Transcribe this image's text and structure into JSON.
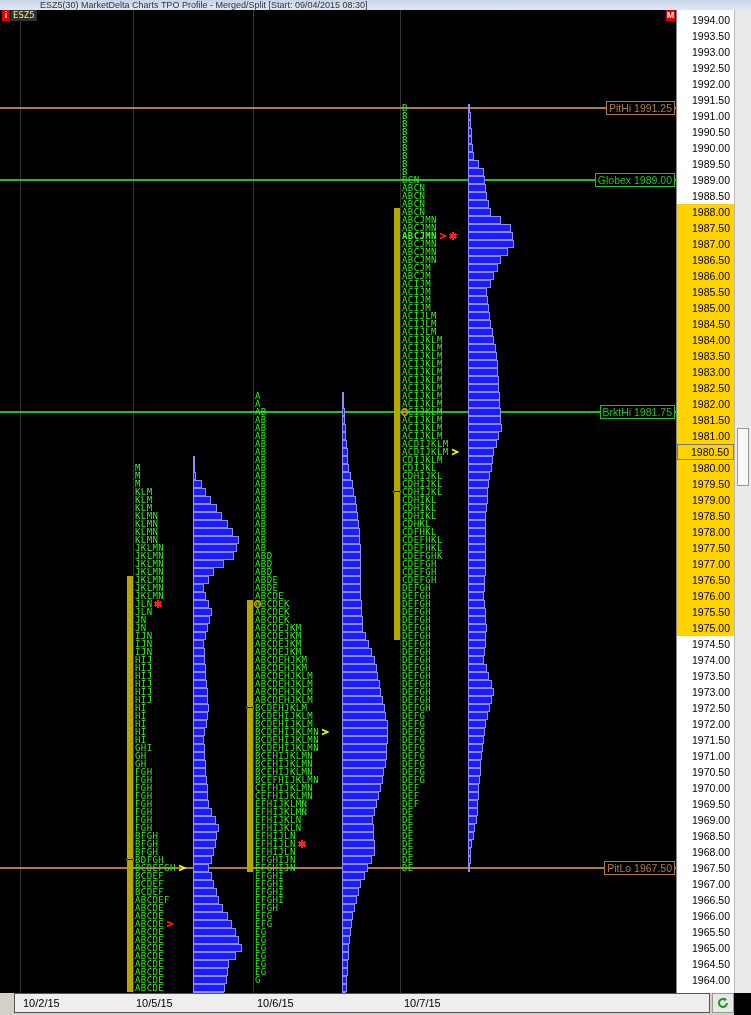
{
  "window": {
    "title": "ESZ5(30) MarketDelta Charts TPO Profile - Merged/Split [Start: 09/04/2015 08:30]"
  },
  "chart": {
    "info_badge": "i",
    "symbol": "ESZ5",
    "mode_badge": "M",
    "profiles": [
      {
        "rows": [
          {
            "tpo": "M",
            "va": false
          },
          {
            "tpo": "M",
            "va": false
          },
          {
            "tpo": "M",
            "va": false
          },
          {
            "tpo": "KLM",
            "va": false
          },
          {
            "tpo": "KLM",
            "va": false
          },
          {
            "tpo": "KLM",
            "va": false
          },
          {
            "tpo": "KLMN",
            "va": false
          },
          {
            "tpo": "KLMN",
            "va": false
          },
          {
            "tpo": "KLMN",
            "va": false
          },
          {
            "tpo": "KLMN",
            "va": false
          },
          {
            "tpo": "JKLMN",
            "va": false
          },
          {
            "tpo": "JKLMN",
            "va": false
          },
          {
            "tpo": "JKLMN",
            "va": false
          },
          {
            "tpo": "JKLMN",
            "va": false
          },
          {
            "tpo": "JKLMN",
            "va": true
          },
          {
            "tpo": "JKLMN",
            "va": true
          },
          {
            "tpo": "JKLMN",
            "va": true
          },
          {
            "tpo": "JLN",
            "va": true,
            "markers": [
              {
                "kind": "star",
                "color": "#ff2020"
              }
            ]
          },
          {
            "tpo": "JLN",
            "va": true
          },
          {
            "tpo": "JN",
            "va": true
          },
          {
            "tpo": "JN",
            "va": true
          },
          {
            "tpo": "IJN",
            "va": true
          },
          {
            "tpo": "IJN",
            "va": true
          },
          {
            "tpo": "IJN",
            "va": true
          },
          {
            "tpo": "HIJ",
            "va": true
          },
          {
            "tpo": "HIJ",
            "va": true
          },
          {
            "tpo": "HIJ",
            "va": true
          },
          {
            "tpo": "HIJ",
            "va": true
          },
          {
            "tpo": "HIJ",
            "va": true
          },
          {
            "tpo": "HIJ",
            "va": true
          },
          {
            "tpo": "HI",
            "va": true
          },
          {
            "tpo": "HI",
            "va": true
          },
          {
            "tpo": "HI",
            "va": true
          },
          {
            "tpo": "HI",
            "va": true
          },
          {
            "tpo": "HI",
            "va": true
          },
          {
            "tpo": "GHI",
            "va": true
          },
          {
            "tpo": "GH",
            "va": true
          },
          {
            "tpo": "GH",
            "va": true
          },
          {
            "tpo": "FGH",
            "va": true
          },
          {
            "tpo": "FGH",
            "va": true
          },
          {
            "tpo": "FGH",
            "va": true
          },
          {
            "tpo": "FGH",
            "va": true
          },
          {
            "tpo": "FGH",
            "va": true
          },
          {
            "tpo": "FGH",
            "va": true
          },
          {
            "tpo": "FGH",
            "va": true
          },
          {
            "tpo": "FGH",
            "va": true
          },
          {
            "tpo": "BFGH",
            "va": true
          },
          {
            "tpo": "BFGH",
            "va": true
          },
          {
            "tpo": "BFGH",
            "va": true
          },
          {
            "tpo": "BDFGH",
            "va": true,
            "mid": true
          },
          {
            "tpo": "BCDEFGH",
            "va": true,
            "markers": [
              {
                "kind": "arrow",
                "color": "#ffff00"
              }
            ]
          },
          {
            "tpo": "BCDEF",
            "va": true
          },
          {
            "tpo": "BCDEF",
            "va": true
          },
          {
            "tpo": "BCDEF",
            "va": true
          },
          {
            "tpo": "ABCDEF",
            "va": true
          },
          {
            "tpo": "ABCDE",
            "va": true
          },
          {
            "tpo": "ABCDE",
            "va": true
          },
          {
            "tpo": "ABCDE",
            "va": true,
            "markers": [
              {
                "kind": "arrow",
                "color": "#ff2020"
              }
            ]
          },
          {
            "tpo": "ABCDE",
            "va": true
          },
          {
            "tpo": "ABCDE",
            "va": true
          },
          {
            "tpo": "ABCDE",
            "va": true
          },
          {
            "tpo": "ABCDE",
            "va": true
          },
          {
            "tpo": "ABCDE",
            "va": true
          },
          {
            "tpo": "ABCDE",
            "va": true
          },
          {
            "tpo": "ABCDE",
            "va": true
          },
          {
            "tpo": "ABCDE",
            "va": true
          }
        ]
      },
      {
        "rows": [
          {
            "tpo": "A",
            "va": false
          },
          {
            "tpo": "A",
            "va": false
          },
          {
            "tpo": "AB",
            "va": false
          },
          {
            "tpo": "AB",
            "va": false
          },
          {
            "tpo": "AB",
            "va": false
          },
          {
            "tpo": "AB",
            "va": false
          },
          {
            "tpo": "AB",
            "va": false
          },
          {
            "tpo": "AB",
            "va": false
          },
          {
            "tpo": "AB",
            "va": false
          },
          {
            "tpo": "AB",
            "va": false
          },
          {
            "tpo": "AB",
            "va": false
          },
          {
            "tpo": "AB",
            "va": false
          },
          {
            "tpo": "AB",
            "va": false
          },
          {
            "tpo": "AB",
            "va": false
          },
          {
            "tpo": "AB",
            "va": false
          },
          {
            "tpo": "AB",
            "va": false
          },
          {
            "tpo": "AB",
            "va": false
          },
          {
            "tpo": "AB",
            "va": false
          },
          {
            "tpo": "AB",
            "va": false
          },
          {
            "tpo": "AB",
            "va": false
          },
          {
            "tpo": "ABD",
            "va": false
          },
          {
            "tpo": "ABD",
            "va": false
          },
          {
            "tpo": "ABD",
            "va": false
          },
          {
            "tpo": "ABDE",
            "va": false
          },
          {
            "tpo": "ABDE",
            "va": false
          },
          {
            "tpo": "ABCDE",
            "va": false
          },
          {
            "tpo": "ABCDEK",
            "va": true,
            "open": true
          },
          {
            "tpo": "ABCDEK",
            "va": true
          },
          {
            "tpo": "ABCDEK",
            "va": true
          },
          {
            "tpo": "ABCDEJKM",
            "va": true
          },
          {
            "tpo": "ABCDEJKM",
            "va": true
          },
          {
            "tpo": "ABCDEJKM",
            "va": true
          },
          {
            "tpo": "ABCDEJKM",
            "va": true
          },
          {
            "tpo": "ABCDEHJKM",
            "va": true
          },
          {
            "tpo": "ABCDEHJKM",
            "va": true
          },
          {
            "tpo": "ABCDEHJKLM",
            "va": true
          },
          {
            "tpo": "ABCDEHJKLM",
            "va": true
          },
          {
            "tpo": "ABCDEHJKLM",
            "va": true
          },
          {
            "tpo": "ABCDEHJKLM",
            "va": true
          },
          {
            "tpo": "BCDEHJKLM",
            "va": true,
            "mid": true
          },
          {
            "tpo": "BCDEHIJKLM",
            "va": true
          },
          {
            "tpo": "BCDEHIJKLM",
            "va": true
          },
          {
            "tpo": "BCDEHIJKLMN",
            "va": true,
            "markers": [
              {
                "kind": "arrow",
                "color": "#ffff00"
              }
            ]
          },
          {
            "tpo": "BCDEHIJKLMN",
            "va": true
          },
          {
            "tpo": "BCDEHIJKLMN",
            "va": true
          },
          {
            "tpo": "BCEHIJKLMN",
            "va": true
          },
          {
            "tpo": "BCEHIJKLMN",
            "va": true
          },
          {
            "tpo": "BCEHIJKLMN",
            "va": true
          },
          {
            "tpo": "BCEFHIJKLMN",
            "va": true
          },
          {
            "tpo": "CEFHIJKLMN",
            "va": true
          },
          {
            "tpo": "CEFHIJKLMN",
            "va": true
          },
          {
            "tpo": "EFHIJKLMN",
            "va": true
          },
          {
            "tpo": "EFHIJKLMN",
            "va": true
          },
          {
            "tpo": "EFHIJKLN",
            "va": true
          },
          {
            "tpo": "EFHIJKLN",
            "va": true
          },
          {
            "tpo": "EFHIJLN",
            "va": true
          },
          {
            "tpo": "EFHIJLN",
            "va": true,
            "markers": [
              {
                "kind": "star",
                "color": "#ff2020"
              }
            ]
          },
          {
            "tpo": "EFHIJLN",
            "va": true
          },
          {
            "tpo": "EFGHIJN",
            "va": true
          },
          {
            "tpo": "EFGHIJN",
            "va": true
          },
          {
            "tpo": "EFGHI",
            "va": false
          },
          {
            "tpo": "EFGHI",
            "va": false
          },
          {
            "tpo": "EFGHI",
            "va": false
          },
          {
            "tpo": "EFGHI",
            "va": false
          },
          {
            "tpo": "EFGH",
            "va": false
          },
          {
            "tpo": "EFG",
            "va": false
          },
          {
            "tpo": "EFG",
            "va": false
          },
          {
            "tpo": "EG",
            "va": false
          },
          {
            "tpo": "EG",
            "va": false
          },
          {
            "tpo": "EG",
            "va": false
          },
          {
            "tpo": "EG",
            "va": false
          },
          {
            "tpo": "EG",
            "va": false
          },
          {
            "tpo": "EG",
            "va": false
          },
          {
            "tpo": "G",
            "va": false
          }
        ]
      },
      {
        "rows": [
          {
            "tpo": "B",
            "va": false
          },
          {
            "tpo": "B",
            "va": false
          },
          {
            "tpo": "B",
            "va": false
          },
          {
            "tpo": "B",
            "va": false
          },
          {
            "tpo": "B",
            "va": false
          },
          {
            "tpo": "B",
            "va": false
          },
          {
            "tpo": "B",
            "va": false
          },
          {
            "tpo": "B",
            "va": false
          },
          {
            "tpo": "B",
            "va": false
          },
          {
            "tpo": "BCN",
            "va": false
          },
          {
            "tpo": "ABCN",
            "va": false
          },
          {
            "tpo": "ABCN",
            "va": false
          },
          {
            "tpo": "ABCN",
            "va": false
          },
          {
            "tpo": "ABCN",
            "va": true
          },
          {
            "tpo": "ABCJMN",
            "va": true
          },
          {
            "tpo": "ABCJMN",
            "va": true
          },
          {
            "tpo": "ABCJMN",
            "va": true,
            "bold": true,
            "markers": [
              {
                "kind": "arrow",
                "color": "#ff2020"
              },
              {
                "kind": "star",
                "color": "#ff2020"
              }
            ]
          },
          {
            "tpo": "ABCJMN",
            "va": true
          },
          {
            "tpo": "ABCJMN",
            "va": true
          },
          {
            "tpo": "ABCJMN",
            "va": true
          },
          {
            "tpo": "ABCJM",
            "va": true
          },
          {
            "tpo": "ABCJM",
            "va": true
          },
          {
            "tpo": "ACIJM",
            "va": true
          },
          {
            "tpo": "ACIJM",
            "va": true
          },
          {
            "tpo": "ACIJM",
            "va": true
          },
          {
            "tpo": "ACIJM",
            "va": true
          },
          {
            "tpo": "ACIJLM",
            "va": true
          },
          {
            "tpo": "ACIJLM",
            "va": true
          },
          {
            "tpo": "ACIJLM",
            "va": true
          },
          {
            "tpo": "ACIJKLM",
            "va": true
          },
          {
            "tpo": "ACIJKLM",
            "va": true
          },
          {
            "tpo": "ACIJKLM",
            "va": true
          },
          {
            "tpo": "ACIJKLM",
            "va": true
          },
          {
            "tpo": "ACIJKLM",
            "va": true
          },
          {
            "tpo": "ACIJKLM",
            "va": true
          },
          {
            "tpo": "ACIJKLM",
            "va": true
          },
          {
            "tpo": "ACIJKLM",
            "va": true
          },
          {
            "tpo": "ACIJKLM",
            "va": true
          },
          {
            "tpo": "ACIJKLM",
            "va": true,
            "open": true
          },
          {
            "tpo": "ACIJKLM",
            "va": true
          },
          {
            "tpo": "ACIJKLM",
            "va": true
          },
          {
            "tpo": "ACIJKLM",
            "va": true
          },
          {
            "tpo": "ACDIJKLM",
            "va": true
          },
          {
            "tpo": "ACDIJKLM",
            "va": true,
            "markers": [
              {
                "kind": "arrow",
                "color": "#ffff00"
              }
            ]
          },
          {
            "tpo": "CDIJKLM",
            "va": true
          },
          {
            "tpo": "CDIJKL",
            "va": true
          },
          {
            "tpo": "CDHIJKL",
            "va": true
          },
          {
            "tpo": "CDHIJKL",
            "va": true
          },
          {
            "tpo": "CDHIJKL",
            "va": true,
            "mid": true
          },
          {
            "tpo": "CDHIKL",
            "va": true
          },
          {
            "tpo": "CDHIKL",
            "va": true
          },
          {
            "tpo": "CDHIKL",
            "va": true
          },
          {
            "tpo": "CDHKL",
            "va": true
          },
          {
            "tpo": "CDFHKL",
            "va": true
          },
          {
            "tpo": "CDEFHKL",
            "va": true
          },
          {
            "tpo": "CDEFHKL",
            "va": true
          },
          {
            "tpo": "CDEFGHK",
            "va": true
          },
          {
            "tpo": "CDEFGH",
            "va": true
          },
          {
            "tpo": "CDEFGH",
            "va": true
          },
          {
            "tpo": "CDEFGH",
            "va": true
          },
          {
            "tpo": "DEFGH",
            "va": true
          },
          {
            "tpo": "DEFGH",
            "va": true
          },
          {
            "tpo": "DEFGH",
            "va": true
          },
          {
            "tpo": "DEFGH",
            "va": true
          },
          {
            "tpo": "DEFGH",
            "va": true
          },
          {
            "tpo": "DEFGH",
            "va": true
          },
          {
            "tpo": "DEFGH",
            "va": true
          },
          {
            "tpo": "DEFGH",
            "va": false
          },
          {
            "tpo": "DEFGH",
            "va": false
          },
          {
            "tpo": "DEFGH",
            "va": false
          },
          {
            "tpo": "DEFGH",
            "va": false
          },
          {
            "tpo": "DEFGH",
            "va": false
          },
          {
            "tpo": "DEFGH",
            "va": false
          },
          {
            "tpo": "DEFGH",
            "va": false
          },
          {
            "tpo": "DEFGH",
            "va": false
          },
          {
            "tpo": "DEFGH",
            "va": false
          },
          {
            "tpo": "DEFG",
            "va": false
          },
          {
            "tpo": "DEFG",
            "va": false
          },
          {
            "tpo": "DEFG",
            "va": false
          },
          {
            "tpo": "DEFG",
            "va": false
          },
          {
            "tpo": "DEFG",
            "va": false
          },
          {
            "tpo": "DEFG",
            "va": false
          },
          {
            "tpo": "DEFG",
            "va": false
          },
          {
            "tpo": "DEFG",
            "va": false
          },
          {
            "tpo": "DEFG",
            "va": false
          },
          {
            "tpo": "DEF",
            "va": false
          },
          {
            "tpo": "DEF",
            "va": false
          },
          {
            "tpo": "DEF",
            "va": false
          },
          {
            "tpo": "DE",
            "va": false
          },
          {
            "tpo": "DE",
            "va": false
          },
          {
            "tpo": "DE",
            "va": false
          },
          {
            "tpo": "DE",
            "va": false
          },
          {
            "tpo": "DE",
            "va": false
          },
          {
            "tpo": "DE",
            "va": false
          },
          {
            "tpo": "DE",
            "va": false
          },
          {
            "tpo": "DE",
            "va": false
          }
        ]
      }
    ],
    "reference_lines": [
      {
        "label": "PitHi 1991.25",
        "color": "#b07a3a"
      },
      {
        "label": "Globex 1989.00",
        "color": "#20c020"
      },
      {
        "label": "BrktHi 1981.75",
        "color": "#20c020"
      },
      {
        "label": "PitLo 1967.50",
        "color": "#b07a3a"
      }
    ],
    "price_axis": [
      {
        "text": "1994.00",
        "highlighted": false,
        "current": false
      },
      {
        "text": "1993.50",
        "highlighted": false,
        "current": false
      },
      {
        "text": "1993.00",
        "highlighted": false,
        "current": false
      },
      {
        "text": "1992.50",
        "highlighted": false,
        "current": false
      },
      {
        "text": "1992.00",
        "highlighted": false,
        "current": false
      },
      {
        "text": "1991.50",
        "highlighted": false,
        "current": false
      },
      {
        "text": "1991.00",
        "highlighted": false,
        "current": false
      },
      {
        "text": "1990.50",
        "highlighted": false,
        "current": false
      },
      {
        "text": "1990.00",
        "highlighted": false,
        "current": false
      },
      {
        "text": "1989.50",
        "highlighted": false,
        "current": false
      },
      {
        "text": "1989.00",
        "highlighted": false,
        "current": false
      },
      {
        "text": "1988.50",
        "highlighted": false,
        "current": false
      },
      {
        "text": "1988.00",
        "highlighted": true,
        "current": false
      },
      {
        "text": "1987.50",
        "highlighted": true,
        "current": false
      },
      {
        "text": "1987.00",
        "highlighted": true,
        "current": false
      },
      {
        "text": "1986.50",
        "highlighted": true,
        "current": false
      },
      {
        "text": "1986.00",
        "highlighted": true,
        "current": false
      },
      {
        "text": "1985.50",
        "highlighted": true,
        "current": false
      },
      {
        "text": "1985.00",
        "highlighted": true,
        "current": false
      },
      {
        "text": "1984.50",
        "highlighted": true,
        "current": false
      },
      {
        "text": "1984.00",
        "highlighted": true,
        "current": false
      },
      {
        "text": "1983.50",
        "highlighted": true,
        "current": false
      },
      {
        "text": "1983.00",
        "highlighted": true,
        "current": false
      },
      {
        "text": "1982.50",
        "highlighted": true,
        "current": false
      },
      {
        "text": "1982.00",
        "highlighted": true,
        "current": false
      },
      {
        "text": "1981.50",
        "highlighted": true,
        "current": false
      },
      {
        "text": "1981.00",
        "highlighted": true,
        "current": false
      },
      {
        "text": "1980.50",
        "highlighted": true,
        "current": true
      },
      {
        "text": "1980.00",
        "highlighted": true,
        "current": false
      },
      {
        "text": "1979.50",
        "highlighted": true,
        "current": false
      },
      {
        "text": "1979.00",
        "highlighted": true,
        "current": false
      },
      {
        "text": "1978.50",
        "highlighted": true,
        "current": false
      },
      {
        "text": "1978.00",
        "highlighted": true,
        "current": false
      },
      {
        "text": "1977.50",
        "highlighted": true,
        "current": false
      },
      {
        "text": "1977.00",
        "highlighted": true,
        "current": false
      },
      {
        "text": "1976.50",
        "highlighted": true,
        "current": false
      },
      {
        "text": "1976.00",
        "highlighted": true,
        "current": false
      },
      {
        "text": "1975.50",
        "highlighted": true,
        "current": false
      },
      {
        "text": "1975.00",
        "highlighted": true,
        "current": false
      },
      {
        "text": "1974.50",
        "highlighted": false,
        "current": false
      },
      {
        "text": "1974.00",
        "highlighted": false,
        "current": false
      },
      {
        "text": "1973.50",
        "highlighted": false,
        "current": false
      },
      {
        "text": "1973.00",
        "highlighted": false,
        "current": false
      },
      {
        "text": "1972.50",
        "highlighted": false,
        "current": false
      },
      {
        "text": "1972.00",
        "highlighted": false,
        "current": false
      },
      {
        "text": "1971.50",
        "highlighted": false,
        "current": false
      },
      {
        "text": "1971.00",
        "highlighted": false,
        "current": false
      },
      {
        "text": "1970.50",
        "highlighted": false,
        "current": false
      },
      {
        "text": "1970.00",
        "highlighted": false,
        "current": false
      },
      {
        "text": "1969.50",
        "highlighted": false,
        "current": false
      },
      {
        "text": "1969.00",
        "highlighted": false,
        "current": false
      },
      {
        "text": "1968.50",
        "highlighted": false,
        "current": false
      },
      {
        "text": "1968.00",
        "highlighted": false,
        "current": false
      },
      {
        "text": "1967.50",
        "highlighted": false,
        "current": false
      },
      {
        "text": "1967.00",
        "highlighted": false,
        "current": false
      },
      {
        "text": "1966.50",
        "highlighted": false,
        "current": false
      },
      {
        "text": "1966.00",
        "highlighted": false,
        "current": false
      },
      {
        "text": "1965.50",
        "highlighted": false,
        "current": false
      },
      {
        "text": "1965.00",
        "highlighted": false,
        "current": false
      },
      {
        "text": "1964.50",
        "highlighted": false,
        "current": false
      },
      {
        "text": "1964.00",
        "highlighted": false,
        "current": false
      }
    ],
    "date_axis": [
      "10/2/15",
      "10/5/15",
      "10/6/15",
      "10/7/15"
    ]
  }
}
